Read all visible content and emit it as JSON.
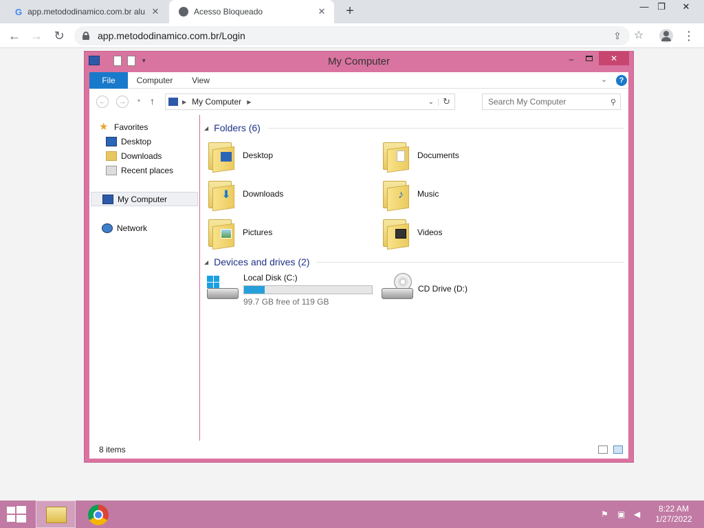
{
  "browser": {
    "tabs": [
      {
        "title": "app.metododinamico.com.br alu",
        "close": "✕"
      },
      {
        "title": "Acesso Bloqueado",
        "close": "✕"
      }
    ],
    "new_tab": "+",
    "url": "app.metododinamico.com.br/Login"
  },
  "explorer": {
    "title": "My Computer",
    "ribbon_tabs": [
      "File",
      "Computer",
      "View"
    ],
    "address": "My Computer",
    "search_placeholder": "Search My Computer",
    "nav": {
      "favorites": "Favorites",
      "desktop": "Desktop",
      "downloads": "Downloads",
      "recent": "Recent places",
      "computer": "My Computer",
      "network": "Network"
    },
    "folders_header": "Folders (6)",
    "folders": [
      "Desktop",
      "Documents",
      "Downloads",
      "Music",
      "Pictures",
      "Videos"
    ],
    "devices_header": "Devices and drives (2)",
    "drives": [
      {
        "name": "Local Disk (C:)",
        "free": "99.7 GB free of 119 GB",
        "used_fraction": 0.16
      },
      {
        "name": "CD Drive (D:)"
      }
    ],
    "status": "8 items"
  },
  "taskbar": {
    "time": "8:22 AM",
    "date": "1/27/2022"
  },
  "colors": {
    "window_frame": "#d9739f",
    "taskbar": "#c17aa4",
    "file_tab": "#1979ca",
    "close_button": "#c7466f",
    "header_text": "#1e3287",
    "drive_bar": "#26a0da"
  }
}
